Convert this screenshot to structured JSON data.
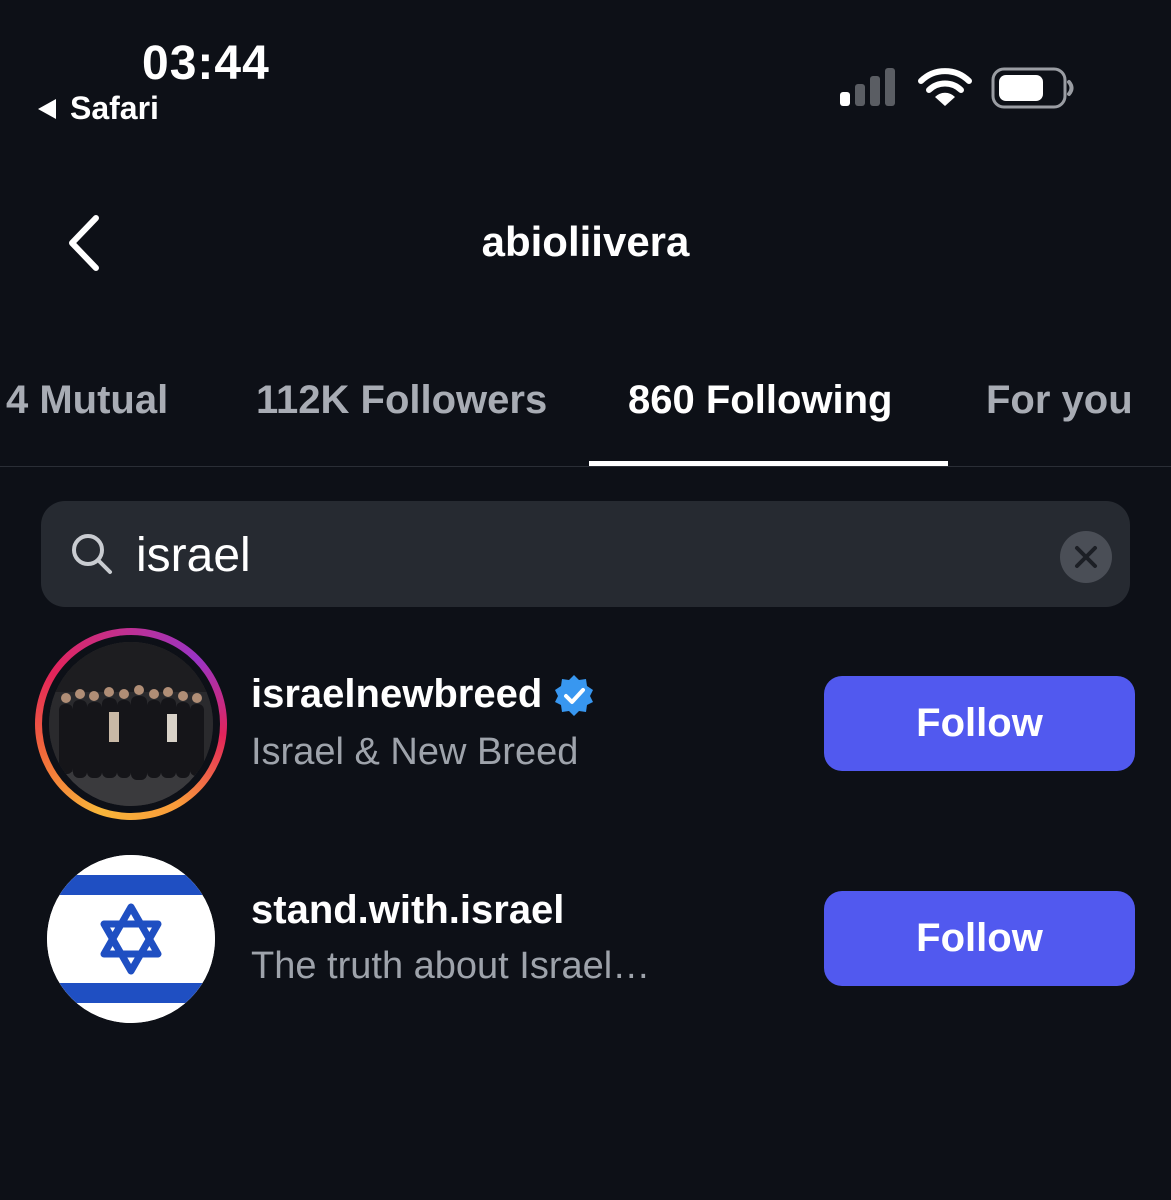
{
  "status_bar": {
    "time": "03:44",
    "back_app_label": "Safari"
  },
  "header": {
    "title": "abioliivera"
  },
  "tabs": [
    {
      "label": "4 Mutual",
      "active": false
    },
    {
      "label": "112K Followers",
      "active": false
    },
    {
      "label": "860 Following",
      "active": true
    },
    {
      "label": "For you",
      "active": false
    }
  ],
  "search": {
    "value": "israel"
  },
  "results": [
    {
      "username": "israelnewbreed",
      "full_name": "Israel & New Breed",
      "verified": true,
      "has_story_ring": true,
      "avatar": "group-photo",
      "button_label": "Follow"
    },
    {
      "username": "stand.with.israel",
      "full_name": "The truth about Israel…",
      "verified": false,
      "has_story_ring": false,
      "avatar": "israel-flag",
      "button_label": "Follow"
    }
  ],
  "colors": {
    "background": "#0d1017",
    "search_bg": "#262a31",
    "follow_button": "#5159ef",
    "verified_badge": "#3897f0",
    "flag_blue": "#1f4fc2"
  },
  "icons": [
    "back-chevron-icon",
    "search-icon",
    "clear-icon",
    "verified-badge-icon",
    "signal-icon",
    "wifi-icon",
    "battery-icon"
  ]
}
